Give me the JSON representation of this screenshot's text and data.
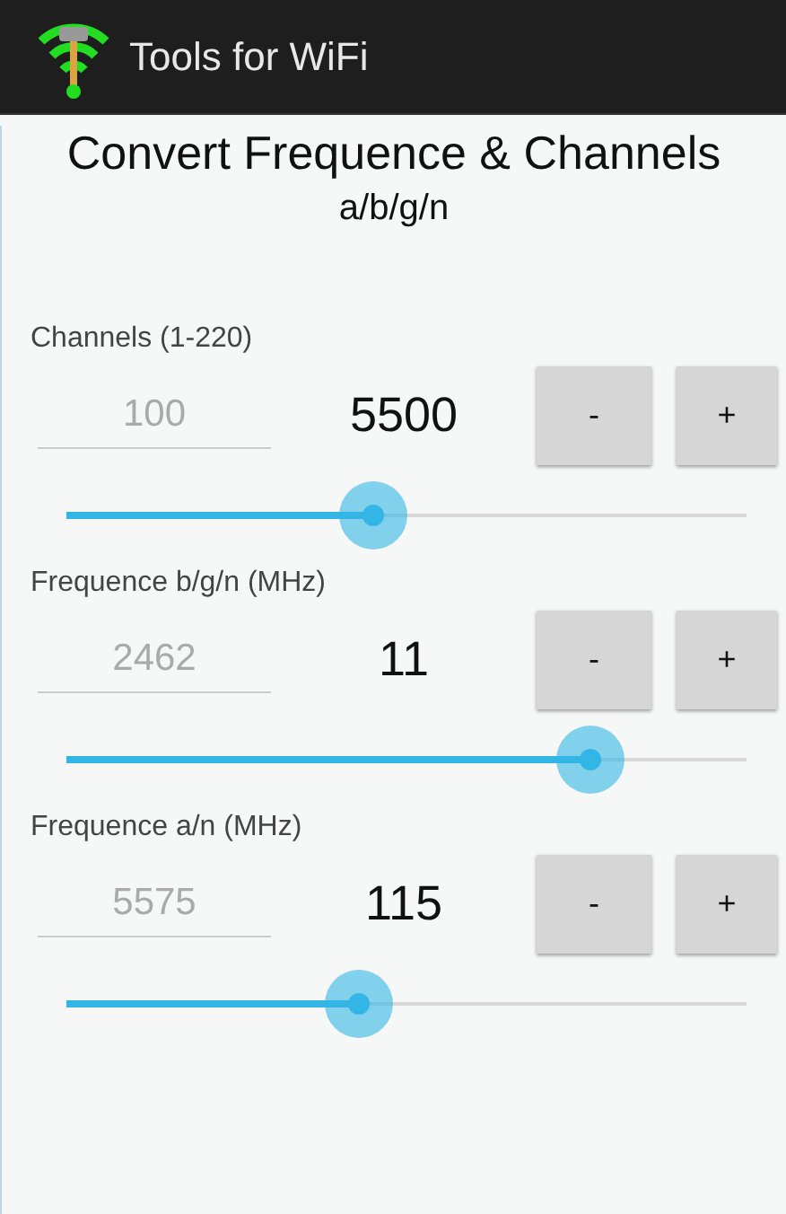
{
  "app_bar": {
    "title": "Tools for WiFi"
  },
  "heading": {
    "title": "Convert Frequence & Channels",
    "subtitle": "a/b/g/n"
  },
  "sections": [
    {
      "label": "Channels (1-220)",
      "placeholder": "100",
      "value": "5500",
      "buttons": [
        "-",
        "+"
      ],
      "level": 0.45
    },
    {
      "label": "Frequence b/g/n (MHz)",
      "placeholder": "2462",
      "value": "11",
      "buttons": [
        "-",
        "+"
      ],
      "level": 0.77
    },
    {
      "label": "Frequence a/n (MHz)",
      "placeholder": "5575",
      "value": "115",
      "buttons": [
        "-",
        "+"
      ],
      "level": 0.43
    }
  ]
}
